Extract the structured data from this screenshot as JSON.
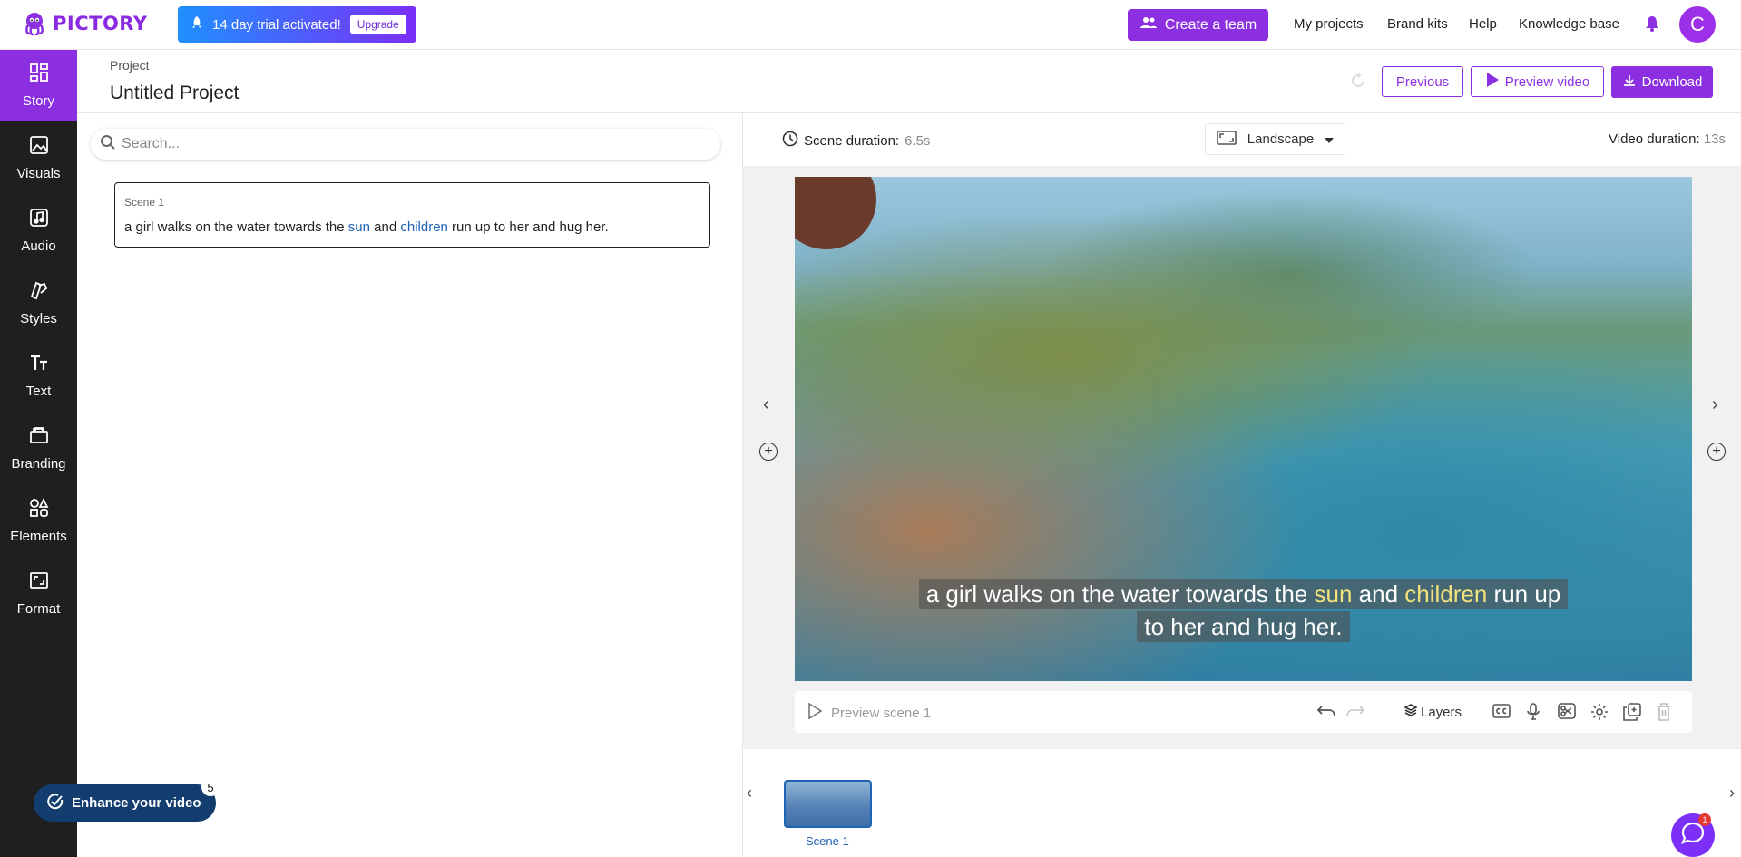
{
  "brand": {
    "name": "PICTORY",
    "color": "#8b2fe0"
  },
  "trial": {
    "message": "14 day trial activated!",
    "upgrade_label": "Upgrade"
  },
  "topnav": {
    "create_team": "Create a team",
    "my_projects": "My projects",
    "brand_kits": "Brand kits",
    "help": "Help",
    "knowledge_base": "Knowledge base",
    "avatar_initial": "C"
  },
  "sidebar": {
    "items": [
      {
        "label": "Story",
        "icon": "story-grid-icon",
        "active": true
      },
      {
        "label": "Visuals",
        "icon": "image-icon"
      },
      {
        "label": "Audio",
        "icon": "music-note-icon"
      },
      {
        "label": "Styles",
        "icon": "styles-icon"
      },
      {
        "label": "Text",
        "icon": "text-icon"
      },
      {
        "label": "Branding",
        "icon": "briefcase-icon"
      },
      {
        "label": "Elements",
        "icon": "elements-icon"
      },
      {
        "label": "Format",
        "icon": "format-icon"
      }
    ],
    "enhance_label": "Enhance your video",
    "enhance_count": "5"
  },
  "project": {
    "label": "Project",
    "title": "Untitled Project"
  },
  "actions": {
    "previous": "Previous",
    "preview_video": "Preview video",
    "download": "Download"
  },
  "story": {
    "search_placeholder": "Search...",
    "scene_label": "Scene 1",
    "scene_text_1": "a girl walks on the water towards the ",
    "scene_hl_1": "sun",
    "scene_text_2": " and ",
    "scene_hl_2": "children",
    "scene_text_3": " run up to her and hug her."
  },
  "editor": {
    "scene_duration_label": "Scene duration:",
    "scene_duration_value": "6.5s",
    "orientation": "Landscape",
    "video_duration_label": "Video duration:",
    "video_duration_value": "13s",
    "caption_1a": "a girl walks on the water towards the ",
    "caption_1b": "sun",
    "caption_1c": " and ",
    "caption_1d": "children",
    "caption_1e": " run up",
    "caption_2": "to her and hug her.",
    "preview_scene": "Preview scene 1",
    "layers": "Layers"
  },
  "timeline": {
    "thumb_label": "Scene 1"
  },
  "chat": {
    "badge": "1"
  }
}
